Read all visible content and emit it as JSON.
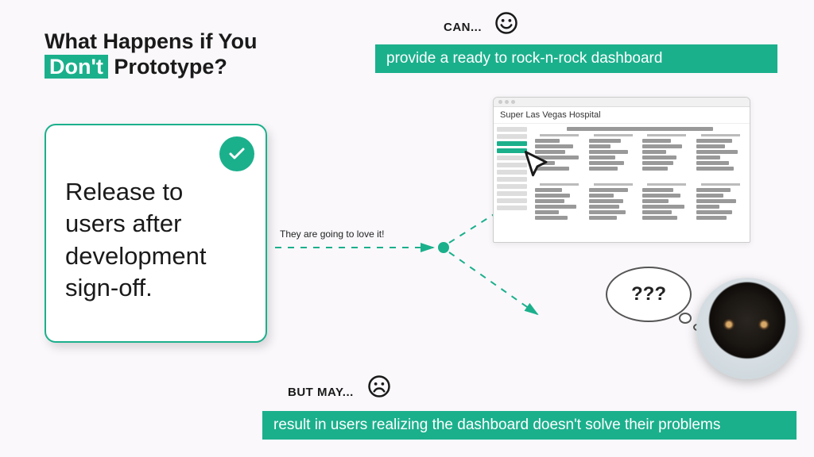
{
  "title": {
    "line1": "What Happens if You",
    "highlight": "Don't",
    "line2_rest": "Prototype?"
  },
  "card": {
    "text": "Release to users after development sign-off."
  },
  "connector": {
    "label": "They are going to love it!"
  },
  "can": {
    "label": "CAN...",
    "banner": "provide a ready to rock-n-rock dashboard"
  },
  "but_may": {
    "label": "BUT MAY...",
    "banner": "result in users realizing the dashboard doesn't solve their problems"
  },
  "dashboard": {
    "title": "Super Las Vegas Hospital"
  },
  "thought": {
    "text": "???"
  },
  "colors": {
    "accent": "#1bb08c"
  }
}
